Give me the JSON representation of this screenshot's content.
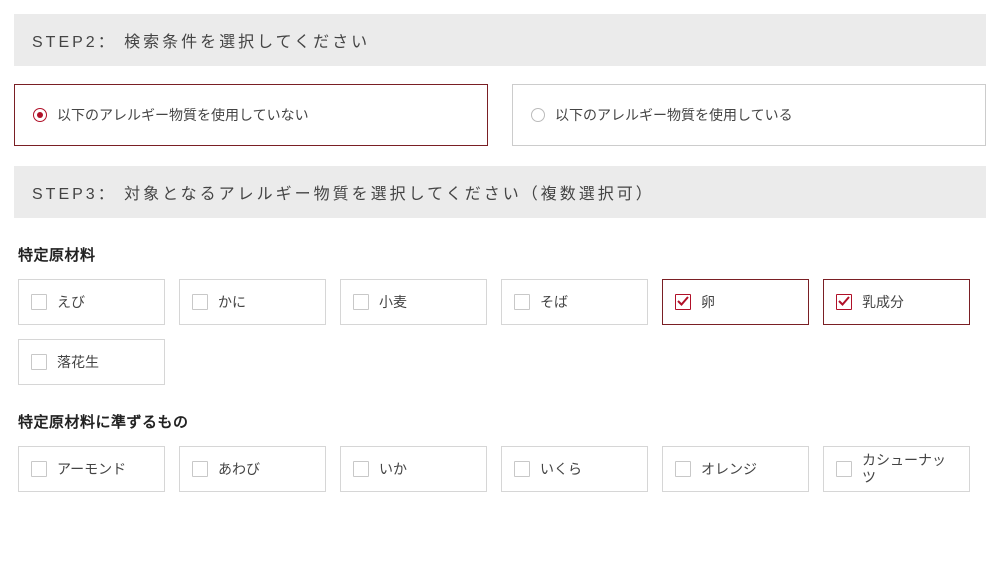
{
  "step2": {
    "header": "STEP2： 検索条件を選択してください",
    "options": [
      {
        "label": "以下のアレルギー物質を使用していない",
        "selected": true
      },
      {
        "label": "以下のアレルギー物質を使用している",
        "selected": false
      }
    ]
  },
  "step3": {
    "header": "STEP3： 対象となるアレルギー物質を選択してください（複数選択可）",
    "group1": {
      "title": "特定原材料",
      "items": [
        {
          "label": "えび",
          "checked": false
        },
        {
          "label": "かに",
          "checked": false
        },
        {
          "label": "小麦",
          "checked": false
        },
        {
          "label": "そば",
          "checked": false
        },
        {
          "label": "卵",
          "checked": true
        },
        {
          "label": "乳成分",
          "checked": true
        },
        {
          "label": "落花生",
          "checked": false
        }
      ]
    },
    "group2": {
      "title": "特定原材料に準ずるもの",
      "items": [
        {
          "label": "アーモンド",
          "checked": false
        },
        {
          "label": "あわび",
          "checked": false
        },
        {
          "label": "いか",
          "checked": false
        },
        {
          "label": "いくら",
          "checked": false
        },
        {
          "label": "オレンジ",
          "checked": false
        },
        {
          "label": "カシューナッツ",
          "checked": false
        }
      ]
    }
  },
  "colors": {
    "accent": "#b01028",
    "selected_border": "#7a1f24"
  }
}
